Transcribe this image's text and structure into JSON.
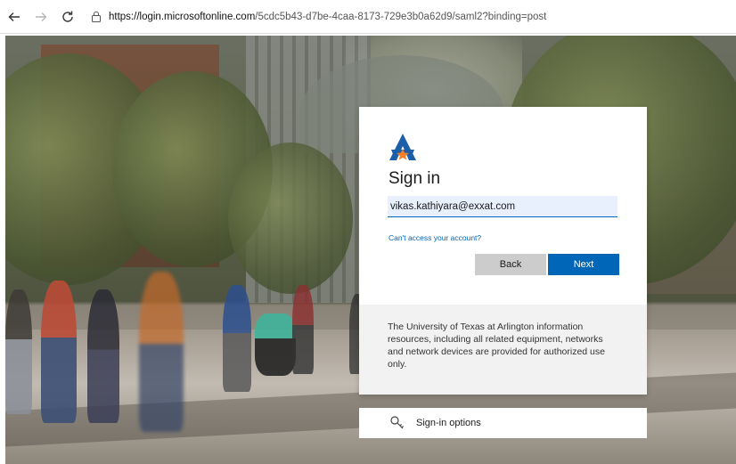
{
  "browser": {
    "url_host": "https://login.microsoftonline.com",
    "url_path": "/5cdc5b43-d7be-4caa-8173-729e3b0a62d9/saml2?binding=post",
    "back_icon": "arrow-left-icon",
    "forward_icon": "arrow-right-icon",
    "reload_icon": "reload-icon",
    "lock_icon": "lock-icon"
  },
  "signin": {
    "title": "Sign in",
    "email_value": "vikas.kathiyara@exxat.com",
    "cant_access": "Can't access your account?",
    "back_label": "Back",
    "next_label": "Next",
    "notice": "The University of Texas at Arlington information resources, including all related equipment, networks and network devices are provided for authorized use only."
  },
  "options": {
    "label": "Sign-in options",
    "icon": "key-icon"
  },
  "colors": {
    "accent": "#0067b8",
    "logo_blue": "#1a5fa8",
    "logo_orange": "#f58025",
    "notice_bg": "#f2f2f2"
  }
}
